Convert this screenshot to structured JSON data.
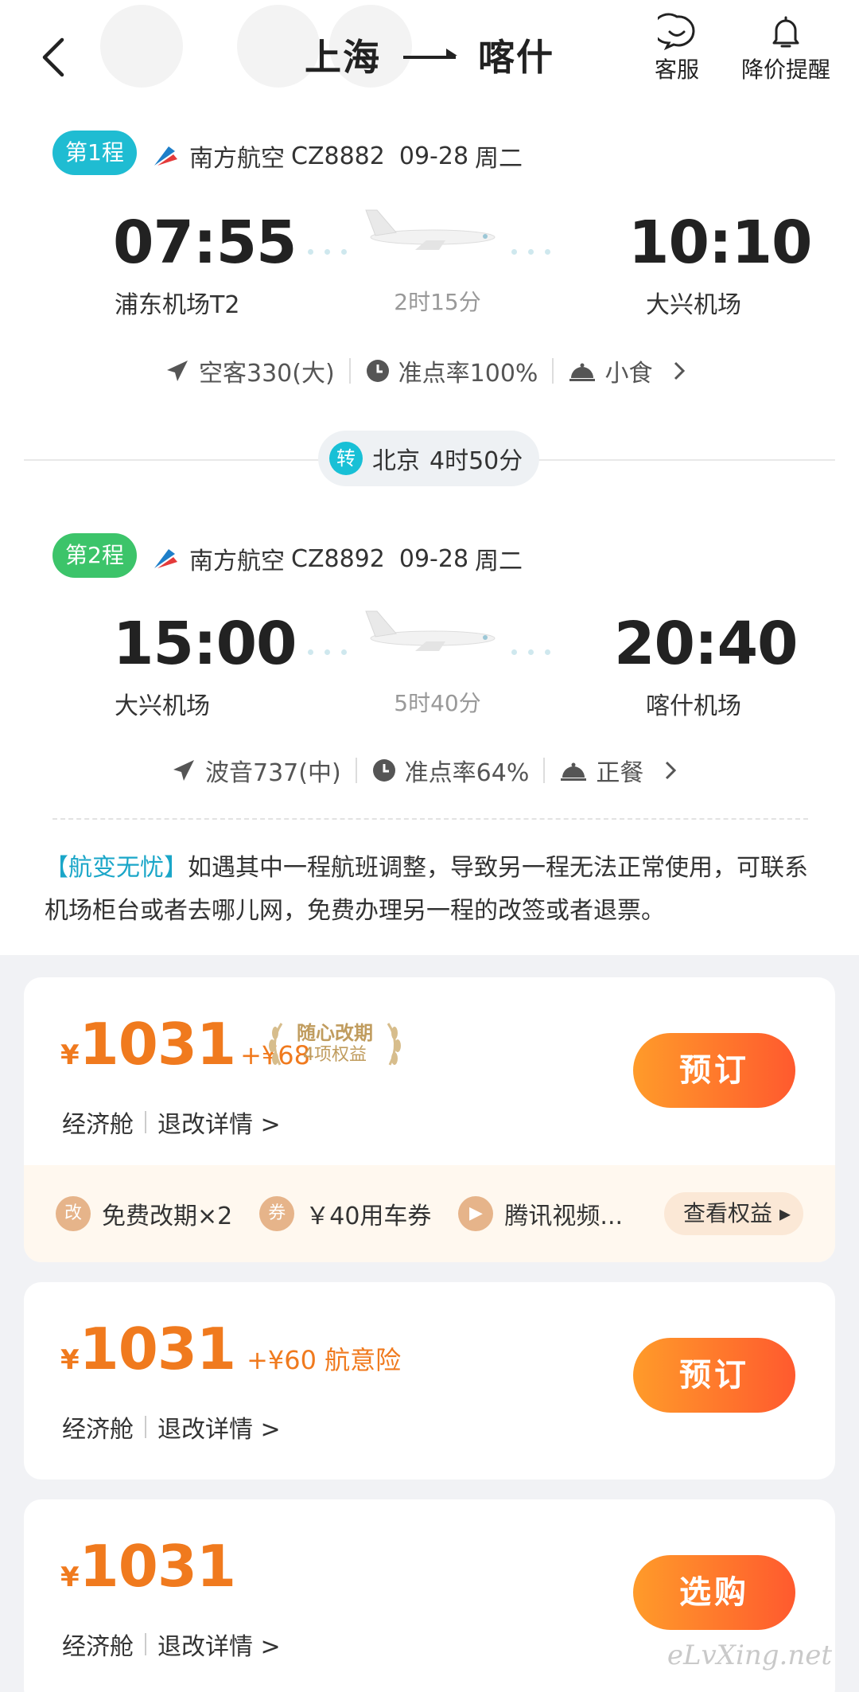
{
  "header": {
    "from": "上海",
    "to": "喀什",
    "service_label": "客服",
    "price_alert_label": "降价提醒"
  },
  "segments": [
    {
      "badge": "第1程",
      "badge_color": "#1fbcd2",
      "airline": "南方航空",
      "flight_no": "CZ8882",
      "date": "09-28",
      "weekday": "周二",
      "dep_time": "07:55",
      "dep_airport": "浦东机场T2",
      "arr_time": "10:10",
      "arr_airport": "大兴机场",
      "duration": "2时15分",
      "aircraft": "空客330(大)",
      "ontime": "准点率100%",
      "meal": "小食"
    },
    {
      "badge": "第2程",
      "badge_color": "#3cc46a",
      "airline": "南方航空",
      "flight_no": "CZ8892",
      "date": "09-28",
      "weekday": "周二",
      "dep_time": "15:00",
      "dep_airport": "大兴机场",
      "arr_time": "20:40",
      "arr_airport": "喀什机场",
      "duration": "5时40分",
      "aircraft": "波音737(中)",
      "ontime": "准点率64%",
      "meal": "正餐"
    }
  ],
  "transfer": {
    "tag": "转",
    "city": "北京",
    "time": "4时50分"
  },
  "notice": {
    "highlight": "【航变无忧】",
    "text": "如遇其中一程航班调整，导致另一程无法正常使用，可联系机场柜台或者去哪儿网，免费办理另一程的改签或者退票。"
  },
  "offers": [
    {
      "currency": "¥",
      "price": "1031",
      "extra": "+¥68",
      "laurel_title": "随心改期",
      "laurel_sub": "4项权益",
      "cabin": "经济舱",
      "rules": "退改详情 >",
      "button": "预订",
      "benefits": [
        {
          "icon": "改",
          "label": "免费改期×2"
        },
        {
          "icon": "券",
          "label": "￥40用车券"
        },
        {
          "icon": "▶",
          "label": "腾讯视频..."
        }
      ],
      "view_benefits": "查看权益"
    },
    {
      "currency": "¥",
      "price": "1031",
      "extra": "+¥60 航意险",
      "cabin": "经济舱",
      "rules": "退改详情 >",
      "button": "预订"
    },
    {
      "currency": "¥",
      "price": "1031",
      "cabin": "经济舱",
      "rules": "退改详情 >",
      "button": "选购"
    }
  ],
  "watermark": "eLvXing.net"
}
